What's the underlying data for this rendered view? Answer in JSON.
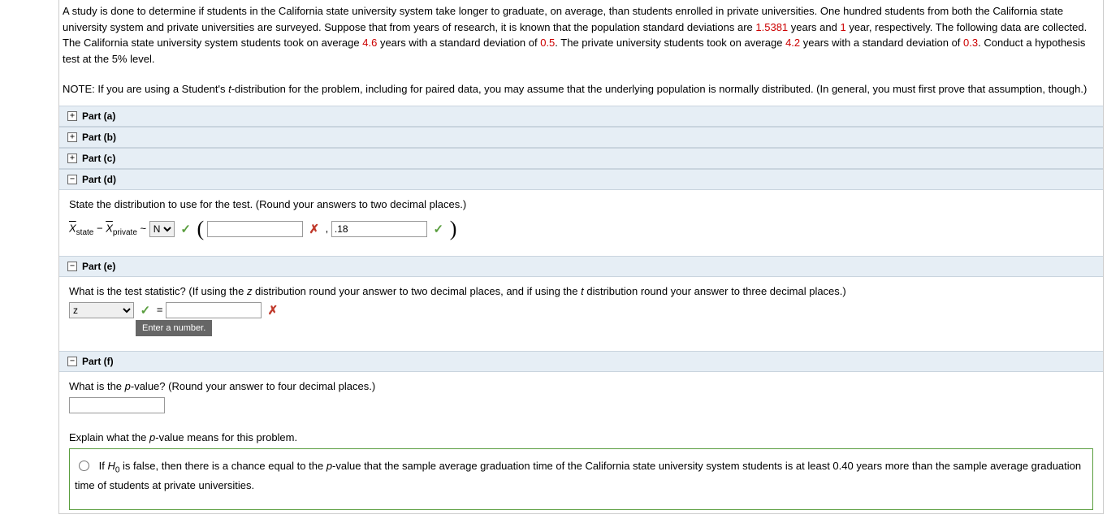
{
  "problem": {
    "text1": "A study is done to determine if students in the California state university system take longer to graduate, on average, than students enrolled in private universities. One hundred students from both the California state university system and private universities are surveyed. Suppose that from years of research, it is known that the population standard deviations are ",
    "val1": "1.5381",
    "text2": " years and ",
    "val2": "1",
    "text3": " year, respectively. The following data are collected. The California state university system students took on average ",
    "val3": "4.6",
    "text4": " years with a standard deviation of ",
    "val4": "0.5",
    "text5": ". The private university students took on average ",
    "val5": "4.2",
    "text6": " years with a standard deviation of ",
    "val6": "0.3",
    "text7": ". Conduct a hypothesis test at the 5% level.",
    "note_prefix": "NOTE: If you are using a Student's ",
    "note_t": "t",
    "note_rest": "-distribution for the problem, including for paired data, you may assume that the underlying population is normally distributed. (In general, you must first prove that assumption, though.)"
  },
  "parts": {
    "a": "Part (a)",
    "b": "Part (b)",
    "c": "Part (c)",
    "d": "Part (d)",
    "e": "Part (e)",
    "f": "Part (f)"
  },
  "partD": {
    "prompt": "State the distribution to use for the test. (Round your answers to two decimal places.)",
    "X": "X",
    "state": "state",
    "minus": " − ",
    "private": "private",
    "tilde": " ~ ",
    "distOptions": [
      "N"
    ],
    "distSelected": "N",
    "comma": " , ",
    "val2": ".18"
  },
  "partE": {
    "prompt1": "What is the test statistic? (If using the ",
    "z": "z",
    "prompt2": " distribution round your answer to two decimal places, and if using the ",
    "t": "t",
    "prompt3": " distribution round your answer to three decimal places.)",
    "statOptions": [
      "z"
    ],
    "statSelected": "z",
    "equals": "  =  ",
    "tooltip": "Enter a number."
  },
  "partF": {
    "prompt": "What is the ",
    "pvalue": "p",
    "prompt2": "-value? (Round your answer to four decimal places.)",
    "explain1": "Explain what the ",
    "explain2": "-value means for this problem.",
    "opt1a": "If ",
    "opt1H": "H",
    "opt1zero": "0",
    "opt1b": " is false, then there is a chance equal to the ",
    "opt1c": "-value that the sample average graduation time of the California state university system students is at least 0.40 years more than the sample average graduation time of students at private universities."
  },
  "icons": {
    "plus": "+",
    "minus": "−",
    "check": "✓",
    "cross": "✗"
  }
}
